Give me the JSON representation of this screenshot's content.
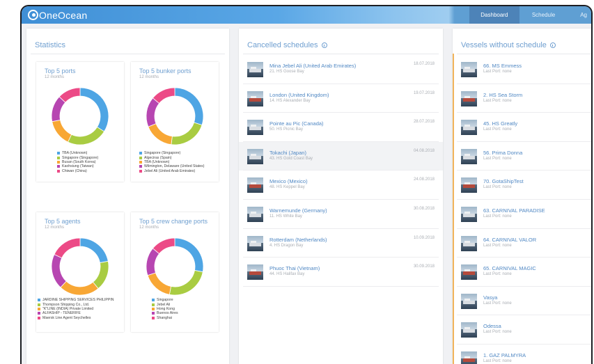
{
  "app": {
    "logo": "OneOcean",
    "nav": [
      "Dashboard",
      "Schedule",
      "Ag"
    ]
  },
  "statistics": {
    "title": "Statistics",
    "cards": [
      {
        "title": "Top 5 ports",
        "subtitle": "12 months",
        "legend": [
          "TBA (Unknown)",
          "Singapore (Singapore)",
          "Busan (South Korea)",
          "Kaohsiung (Taiwan)",
          "Chiwan (China)"
        ]
      },
      {
        "title": "Top 5 bunker ports",
        "subtitle": "12 months",
        "legend": [
          "Singapore (Singapore)",
          "Algeciras (Spain)",
          "TBA (Unknown)",
          "Wilmington, Delaware (United States)",
          "Jebel Ali (United Arab Emirates)"
        ]
      },
      {
        "title": "Top 5 agents",
        "subtitle": "12 months",
        "legend": [
          "JARDINE SHIPPING SERVICES PHILIPPIN",
          "Thompson Shipping Co., Ltd.",
          "\"K\"LINE (INDIA) Private Limited",
          "ALFASHIP - TENERIFE",
          "Maersk Line Agent Seychelles"
        ]
      },
      {
        "title": "Top 5 crew change ports",
        "subtitle": "12 months",
        "legend": [
          "Singapore",
          "Jebel Ali",
          "Hong Kong",
          "Buenos Aires",
          "Shanghai"
        ]
      }
    ],
    "chart_data": [
      {
        "type": "pie",
        "title": "Top 5 ports",
        "categories": [
          "TBA (Unknown)",
          "Singapore (Singapore)",
          "Busan (South Korea)",
          "Kaohsiung (Taiwan)",
          "Chiwan (China)"
        ],
        "values": [
          34,
          23,
          15,
          15,
          13
        ]
      },
      {
        "type": "pie",
        "title": "Top 5 bunker ports",
        "categories": [
          "Singapore (Singapore)",
          "Algeciras (Spain)",
          "TBA (Unknown)",
          "Wilmington, Delaware (United States)",
          "Jebel Ali (United Arab Emirates)"
        ],
        "values": [
          30,
          22,
          17,
          17,
          14
        ]
      },
      {
        "type": "pie",
        "title": "Top 5 agents",
        "categories": [
          "JARDINE SHIPPING SERVICES PHILIPPIN",
          "Thompson Shipping Co., Ltd.",
          "\"K\"LINE (INDIA) Private Limited",
          "ALFASHIP - TENERIFE",
          "Maersk Line Agent Seychelles"
        ],
        "values": [
          22,
          17,
          23,
          20,
          18
        ]
      },
      {
        "type": "pie",
        "title": "Top 5 crew change ports",
        "categories": [
          "Singapore",
          "Jebel Ali",
          "Hong Kong",
          "Buenos Aires",
          "Shanghai"
        ],
        "values": [
          28,
          25,
          17,
          16,
          14
        ]
      }
    ],
    "colors": [
      "#4ea5e4",
      "#a9cc42",
      "#f8a735",
      "#b746b1",
      "#ec4a86"
    ]
  },
  "cancelled": {
    "title": "Cancelled schedules",
    "items": [
      {
        "title": "Mina Jebel Ali (United Arab Emirates)",
        "sub": "21. HS Goose Bay",
        "date": "18.07.2018"
      },
      {
        "title": "London (United Kingdom)",
        "sub": "14. HS Alexander Bay",
        "date": "19.07.2018"
      },
      {
        "title": "Pointe au Pic (Canada)",
        "sub": "50. HS Picnic Bay",
        "date": "28.07.2018"
      },
      {
        "title": "Tokachi (Japan)",
        "sub": "43. HS Gold Coast Bay",
        "date": "04.08.2018"
      },
      {
        "title": "Mexico (Mexico)",
        "sub": "48. HS Keppel Bay",
        "date": "24.08.2018"
      },
      {
        "title": "Warnemunde (Germany)",
        "sub": "11. HS White Bay",
        "date": "30.08.2018"
      },
      {
        "title": "Rotterdam (Netherlands)",
        "sub": "4. HS Dragon Bay",
        "date": "10.09.2018"
      },
      {
        "title": "Phuoc Thai (Vietnam)",
        "sub": "44. HS Halifax Bay",
        "date": "30.09.2018"
      }
    ]
  },
  "vessels": {
    "title": "Vessels without schedule",
    "items": [
      {
        "title": "66. MS Emmess",
        "sub": "Last Port: none"
      },
      {
        "title": "2. HS Sea Storm",
        "sub": "Last Port: none"
      },
      {
        "title": "45. HS Greatly",
        "sub": "Last Port: none"
      },
      {
        "title": "56. Prima Donna",
        "sub": "Last Port: none"
      },
      {
        "title": "70. GotaShipTest",
        "sub": "Last Port: none"
      },
      {
        "title": "63. CARNIVAL PARADISE",
        "sub": "Last Port: none"
      },
      {
        "title": "64. CARNIVAL VALOR",
        "sub": "Last Port: none"
      },
      {
        "title": "65. CARNIVAL MAGIC",
        "sub": "Last Port: none"
      },
      {
        "title": "Vasya",
        "sub": "Last Port: none"
      },
      {
        "title": "Odessa",
        "sub": "Last Port: none"
      },
      {
        "title": "1. GAZ PALMYRA",
        "sub": "Last Port: none"
      }
    ]
  }
}
